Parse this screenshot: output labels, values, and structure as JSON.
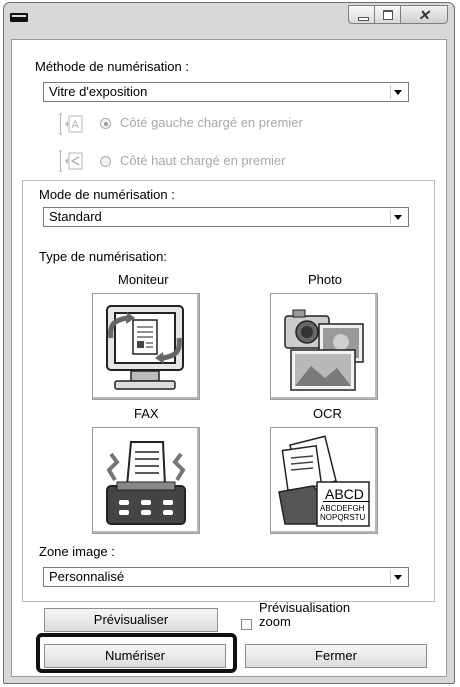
{
  "window": {
    "title_icon": "twain-app-icon",
    "controls": [
      "minimize-icon",
      "maximize-icon",
      "close-icon"
    ]
  },
  "scan_method": {
    "label": "Méthode de numérisation :",
    "value": "Vitre d'exposition",
    "options": [
      {
        "label": "Côté gauche chargé en premier",
        "selected": true,
        "enabled": false
      },
      {
        "label": "Côté haut chargé en premier",
        "selected": false,
        "enabled": false
      }
    ]
  },
  "scan_mode": {
    "label": "Mode de numérisation :",
    "value": "Standard"
  },
  "scan_type": {
    "label": "Type de numérisation:",
    "tiles": [
      {
        "label": "Moniteur",
        "icon": "monitor-icon"
      },
      {
        "label": "Photo",
        "icon": "photo-icon"
      },
      {
        "label": "FAX",
        "icon": "fax-icon"
      },
      {
        "label": "OCR",
        "icon": "ocr-icon",
        "ocr_big": "ABCD",
        "ocr_line1": "ABCDEFGH",
        "ocr_line2": "NOPQRSTU"
      }
    ]
  },
  "image_zone": {
    "label": "Zone image :",
    "value": "Personnalisé"
  },
  "buttons": {
    "preview": "Prévisualiser",
    "preview_zoom_line1": "Prévisualisation",
    "preview_zoom_line2": "zoom",
    "scan": "Numériser",
    "close": "Fermer"
  }
}
